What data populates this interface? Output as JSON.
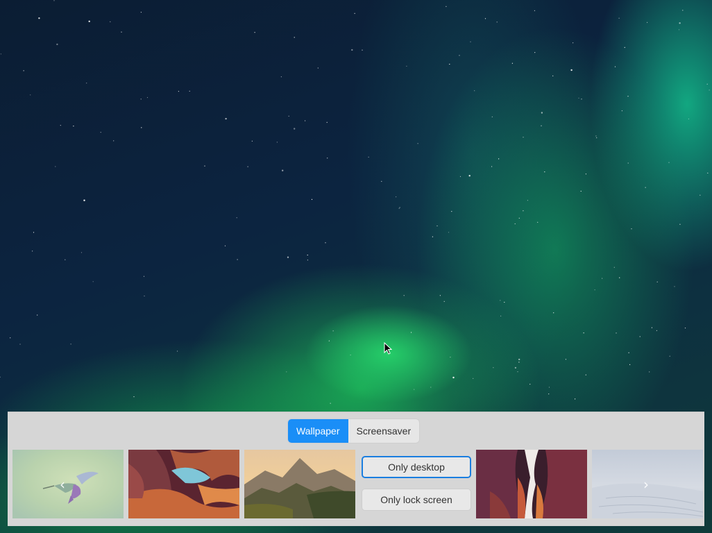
{
  "tabs": {
    "wallpaper": "Wallpaper",
    "screensaver": "Screensaver",
    "active": "wallpaper"
  },
  "thumbnails": [
    {
      "name": "hummingbird",
      "selected": true
    },
    {
      "name": "sandstone-arch"
    },
    {
      "name": "mountain-valley"
    },
    {
      "name": "canyon-slot"
    },
    {
      "name": "white-dunes"
    }
  ],
  "actions": {
    "only_desktop": "Only desktop",
    "only_lock_screen": "Only lock screen"
  },
  "icons": {
    "prev": "chevron-left-icon",
    "next": "chevron-right-icon",
    "cursor": "mouse-pointer-icon"
  },
  "colors": {
    "accent": "#1a8ef7",
    "panel": "#d6d6d6"
  }
}
